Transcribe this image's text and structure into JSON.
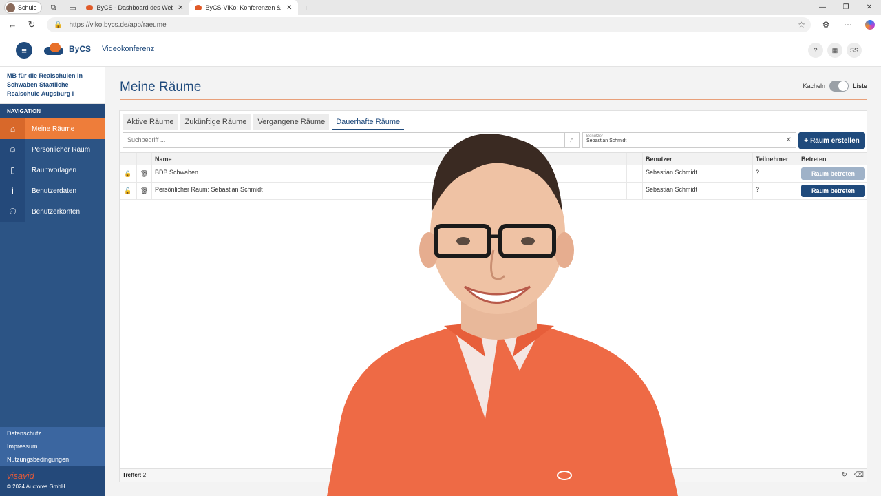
{
  "browser": {
    "profile_label": "Schule",
    "tabs": [
      {
        "title": "ByCS - Dashboard des Web-Portal",
        "active": false
      },
      {
        "title": "ByCS-ViKo: Konferenzen & Webinare",
        "active": true
      }
    ],
    "url": "https://viko.bycs.de/app/raeume"
  },
  "app": {
    "brand": "ByCS",
    "subtitle": "Videokonferenz",
    "user_initials": "SS",
    "help_label": "?"
  },
  "sidebar": {
    "org_name": "MB für die Realschulen in Schwaben Staatliche Realschule Augsburg I",
    "nav_heading": "NAVIGATION",
    "items": [
      {
        "label": "Meine Räume",
        "icon": "building-icon",
        "active": true
      },
      {
        "label": "Persönlicher Raum",
        "icon": "person-icon",
        "active": false
      },
      {
        "label": "Raumvorlagen",
        "icon": "document-icon",
        "active": false
      },
      {
        "label": "Benutzerdaten",
        "icon": "info-icon",
        "active": false
      },
      {
        "label": "Benutzerkonten",
        "icon": "users-icon",
        "active": false
      }
    ],
    "footer_links": [
      "Datenschutz",
      "Impressum",
      "Nutzungsbedingungen"
    ],
    "footer_brand": "visavid",
    "copyright": "© 2024 Auctores GmbH"
  },
  "main": {
    "title": "Meine Räume",
    "view_toggle": {
      "left": "Kacheln",
      "right": "Liste",
      "selected": "Liste"
    },
    "tabs": [
      "Aktive Räume",
      "Zukünftige Räume",
      "Vergangene Räume",
      "Dauerhafte Räume"
    ],
    "active_tab": "Dauerhafte Räume",
    "search_placeholder": "Suchbegriff ...",
    "user_filter": {
      "label": "Benutzer",
      "value": "Sebastian Schmidt"
    },
    "create_button": "Raum erstellen",
    "columns": [
      "Name",
      "Benutzer",
      "Teilnehmer",
      "Betreten"
    ],
    "rows": [
      {
        "locked": true,
        "name": "BDB Schwaben",
        "user": "Sebastian Schmidt",
        "participants": "?",
        "action": "Raum betreten",
        "action_enabled": false
      },
      {
        "locked": false,
        "name": "Persönlicher Raum: Sebastian Schmidt",
        "user": "Sebastian Schmidt",
        "participants": "?",
        "action": "Raum betreten",
        "action_enabled": true
      }
    ],
    "hits_label": "Treffer:",
    "hits_count": "2"
  },
  "colors": {
    "primary": "#1f4a7c",
    "accent": "#ee7d3a",
    "sidebar": "#2c5485"
  }
}
